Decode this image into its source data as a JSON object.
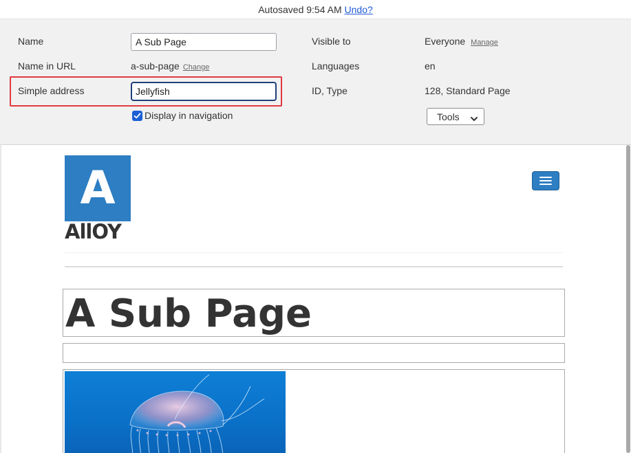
{
  "autosave": {
    "text": "Autosaved 9:54 AM",
    "undo_link": "Undo?"
  },
  "properties": {
    "name_label": "Name",
    "name_value": "A Sub Page",
    "url_label": "Name in URL",
    "url_value": "a-sub-page",
    "url_change_link": "Change",
    "simple_address_label": "Simple address",
    "simple_address_value": "Jellyfish",
    "display_in_nav_label": "Display in navigation",
    "display_in_nav_checked": true,
    "visible_to_label": "Visible to",
    "visible_to_value": "Everyone",
    "manage_link": "Manage",
    "languages_label": "Languages",
    "languages_value": "en",
    "id_type_label": "ID, Type",
    "id_type_value": "128, Standard Page",
    "tools_label": "Tools"
  },
  "preview": {
    "logo_letter": "A",
    "logo_word": "AllOY",
    "page_title": "A Sub Page",
    "image_subject": "jellyfish",
    "brand_color": "#2d7ec2"
  },
  "colors": {
    "panel_bg": "#f1f1f1",
    "highlight": "#e0393e",
    "link": "#1f5bd6",
    "checkbox": "#1e5fd6"
  }
}
